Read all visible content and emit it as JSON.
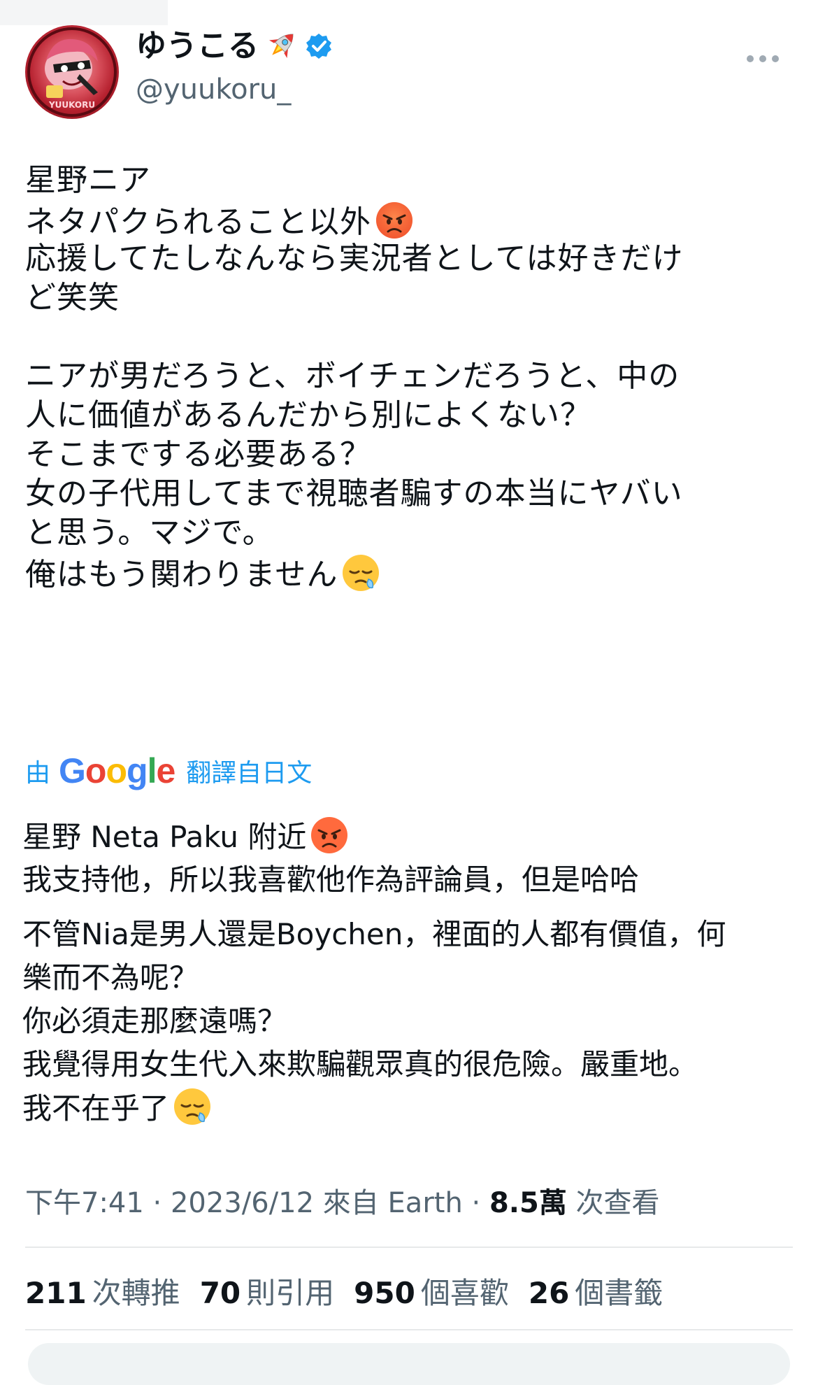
{
  "user": {
    "display_name": "ゆうこる",
    "handle": "@yuukoru_",
    "name_emoji": "rocket-icon",
    "verified": true,
    "avatar_text": "YUUKORU"
  },
  "tweet": {
    "lines": [
      "星野ニア",
      "ネタパクられること以外",
      "応援してたしなんなら実況者としては好きだけ",
      "ど笑笑",
      "",
      "ニアが男だろうと、ボイチェンだろうと、中の",
      "人に価値があるんだから別によくない？",
      "そこまでする必要ある？",
      "女の子代用してまで視聴者騙すの本当にヤバい",
      "と思う。マジで。",
      "俺はもう関わりません"
    ]
  },
  "translate": {
    "by": "由",
    "google": "Google",
    "from": "翻譯自日文"
  },
  "translation": {
    "lines": [
      "星野 Neta Paku 附近",
      "我支持他，所以我喜歡他作為評論員，但是哈哈",
      "不管Nia是男人還是Boychen，裡面的人都有價值，何",
      "樂而不為呢？",
      "你必須走那麼遠嗎？",
      "我覺得用女生代入來欺騙觀眾真的很危險。嚴重地。",
      "我不在乎了"
    ]
  },
  "meta": {
    "time": "下午7:41",
    "dot1": " · ",
    "date": "2023/6/12",
    "source_prefix": " 來自 ",
    "source": "Earth",
    "dot2": " · ",
    "views_count": "8.5萬",
    "views_label": " 次查看"
  },
  "stats": [
    {
      "count": "211",
      "label": "次轉推"
    },
    {
      "count": "70",
      "label": "則引用"
    },
    {
      "count": "950",
      "label": "個喜歡"
    },
    {
      "count": "26",
      "label": "個書籤"
    }
  ],
  "colors": {
    "link_blue": "#1d9bf0",
    "secondary_text": "#536471",
    "primary_text": "#0f1419",
    "divider": "#e7e9ea"
  }
}
